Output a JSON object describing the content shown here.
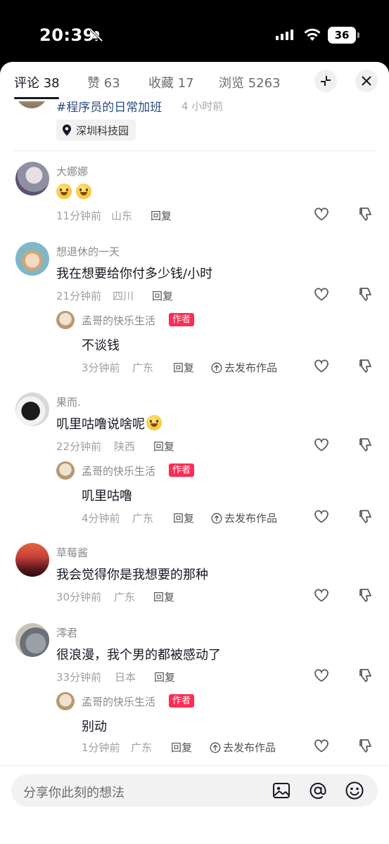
{
  "status_bar": {
    "time": "20:39",
    "battery": "36"
  },
  "tabs": [
    {
      "label": "评论 38"
    },
    {
      "label": "赞 63"
    },
    {
      "label": "收藏 17"
    },
    {
      "label": "浏览 5263"
    }
  ],
  "post": {
    "hashtag": "#程序员的日常加班",
    "time": "4 小时前",
    "location": "深圳科技园"
  },
  "comments": [
    {
      "user": "大娜娜",
      "text": "",
      "emoji_count": 2,
      "time": "11分钟前",
      "region": "山东",
      "reply_label": "回复"
    },
    {
      "user": "想退休的一天",
      "text": "我在想要给你付多少钱/小时",
      "time": "21分钟前",
      "region": "四川",
      "reply_label": "回复",
      "reply": {
        "user": "孟哥的快乐生活",
        "badge": "作者",
        "text": "不谈钱",
        "time": "3分钟前",
        "region": "广东",
        "reply_label": "回复",
        "goto_label": "去发布作品"
      }
    },
    {
      "user": "果而.",
      "text": "叽里咕噜说啥呢",
      "emoji_count": 1,
      "time": "22分钟前",
      "region": "陕西",
      "reply_label": "回复",
      "reply": {
        "user": "孟哥的快乐生活",
        "badge": "作者",
        "text": "叽里咕噜",
        "time": "4分钟前",
        "region": "广东",
        "reply_label": "回复",
        "goto_label": "去发布作品"
      }
    },
    {
      "user": "草莓酱",
      "text": "我会觉得你是我想要的那种",
      "time": "30分钟前",
      "region": "广东",
      "reply_label": "回复"
    },
    {
      "user": "澪君",
      "text": "很浪漫，我个男的都被感动了",
      "time": "33分钟前",
      "region": "日本",
      "reply_label": "回复",
      "reply": {
        "user": "孟哥的快乐生活",
        "badge": "作者",
        "text": "别动",
        "time": "1分钟前",
        "region": "广东",
        "reply_label": "回复",
        "goto_label": "去发布作品"
      }
    }
  ],
  "input": {
    "placeholder": "分享你此刻的想法"
  },
  "colors": {
    "accent": "#fe2c55",
    "hashtag": "#2b4c80",
    "text": "#161823",
    "muted": "#a0a0a6"
  },
  "icons": [
    "bell-slash-icon",
    "signal-icon",
    "wifi-icon",
    "battery-icon",
    "collapse-icon",
    "close-icon",
    "location-pin-icon",
    "like-icon",
    "dislike-icon",
    "up-arrow-circle-icon",
    "image-icon",
    "at-icon",
    "emoji-icon"
  ]
}
